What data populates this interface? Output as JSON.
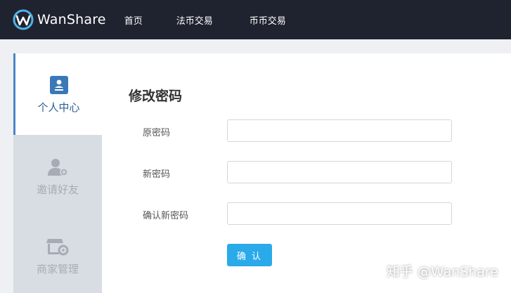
{
  "header": {
    "app_name": "WanShare",
    "logo_icon": "wanshare-logo",
    "nav": [
      {
        "label": "首页"
      },
      {
        "label": "法币交易"
      },
      {
        "label": "币币交易"
      }
    ]
  },
  "sidebar": {
    "items": [
      {
        "label": "个人中心",
        "icon": "user-card-icon",
        "active": true
      },
      {
        "label": "邀请好友",
        "icon": "add-user-icon",
        "active": false
      },
      {
        "label": "商家管理",
        "icon": "store-settings-icon",
        "active": false
      }
    ]
  },
  "main": {
    "title": "修改密码",
    "fields": [
      {
        "label": "原密码",
        "value": ""
      },
      {
        "label": "新密码",
        "value": ""
      },
      {
        "label": "确认新密码",
        "value": ""
      }
    ],
    "submit_label": "确 认"
  },
  "watermark": "知乎 @WanShare",
  "colors": {
    "topbar": "#1f232f",
    "accent": "#2aaae9",
    "active_border": "#4a86c5",
    "sidebar_inactive": "#d8dde3"
  }
}
